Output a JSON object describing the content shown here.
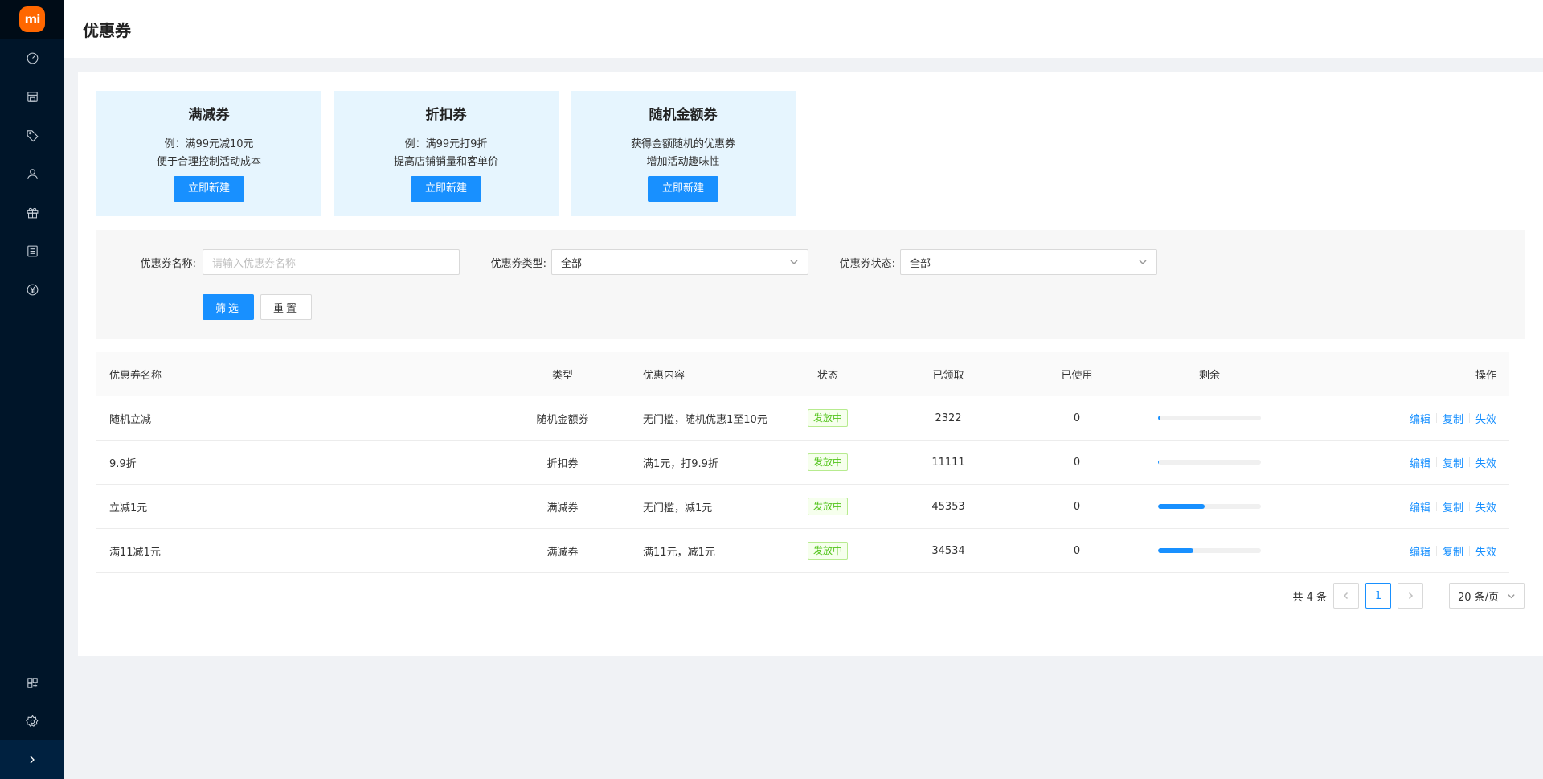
{
  "app": {
    "logo_text": "mi"
  },
  "header": {
    "title": "优惠券"
  },
  "type_cards": [
    {
      "title": "满减券",
      "desc1": "例：满99元减10元",
      "desc2": "便于合理控制活动成本",
      "button": "立即新建"
    },
    {
      "title": "折扣券",
      "desc1": "例：满99元打9折",
      "desc2": "提高店铺销量和客单价",
      "button": "立即新建"
    },
    {
      "title": "随机金额券",
      "desc1": "获得金额随机的优惠券",
      "desc2": "增加活动趣味性",
      "button": "立即新建"
    }
  ],
  "filters": {
    "name_label": "优惠券名称:",
    "name_placeholder": "请输入优惠券名称",
    "type_label": "优惠券类型:",
    "type_value": "全部",
    "status_label": "优惠券状态:",
    "status_value": "全部",
    "filter_button": "筛选",
    "reset_button": "重置"
  },
  "table": {
    "headers": {
      "name": "优惠券名称",
      "type": "类型",
      "content": "优惠内容",
      "status": "状态",
      "received": "已领取",
      "used": "已使用",
      "remaining": "剩余",
      "ops": "操作"
    },
    "rows": [
      {
        "name": "随机立减",
        "type": "随机金额券",
        "content": "无门槛，随机优惠1至10元",
        "status": "发放中",
        "received": "2322",
        "used": "0",
        "remaining_pct": 2
      },
      {
        "name": "9.9折",
        "type": "折扣券",
        "content": "满1元，打9.9折",
        "status": "发放中",
        "received": "11111",
        "used": "0",
        "remaining_pct": 1
      },
      {
        "name": "立减1元",
        "type": "满减券",
        "content": "无门槛，减1元",
        "status": "发放中",
        "received": "45353",
        "used": "0",
        "remaining_pct": 45
      },
      {
        "name": "满11减1元",
        "type": "满减券",
        "content": "满11元，减1元",
        "status": "发放中",
        "received": "34534",
        "used": "0",
        "remaining_pct": 34
      }
    ],
    "ops": {
      "edit": "编辑",
      "copy": "复制",
      "disable": "失效"
    }
  },
  "pagination": {
    "total": "共 4 条",
    "current_page": "1",
    "page_size": "20 条/页"
  },
  "colors": {
    "primary": "#1890ff",
    "sidebar": "#001529",
    "success": "#52c41a",
    "logo": "#ff6700"
  }
}
